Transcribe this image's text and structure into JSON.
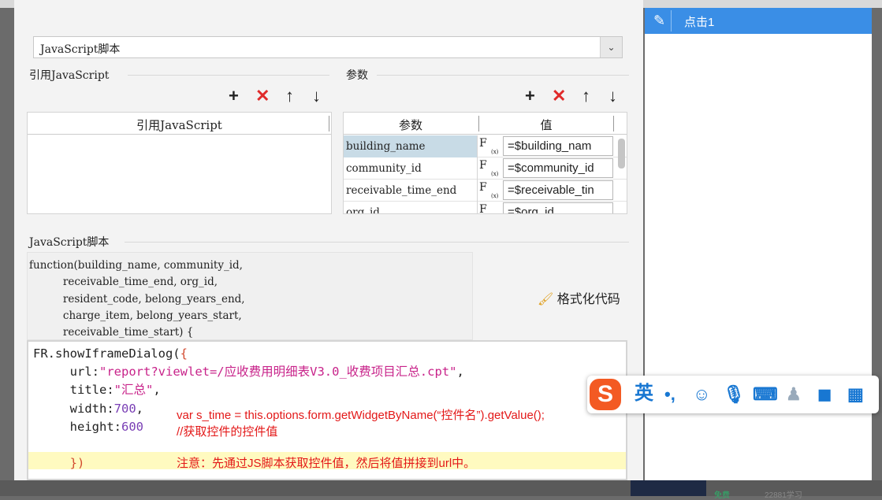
{
  "script_type": "JavaScript脚本",
  "ref_js": {
    "title": "引用JavaScript",
    "column": "引用JavaScript"
  },
  "params": {
    "title": "参数",
    "col_param": "参数",
    "col_value": "值",
    "rows": [
      {
        "name": "building_name",
        "value": "=$building_nam"
      },
      {
        "name": "community_id",
        "value": "=$community_id"
      },
      {
        "name": "receivable_time_end",
        "value": "=$receivable_tin"
      },
      {
        "name": "org_id",
        "value": "=$org_id"
      }
    ]
  },
  "js_section_title": "JavaScript脚本",
  "signature": "function(building_name, community_id,\n          receivable_time_end, org_id,\n          resident_code, belong_years_end,\n          charge_item, belong_years_start,\n          receivable_time_start) {",
  "format_button": "格式化代码",
  "code": {
    "line1": "FR.showIframeDialog(",
    "line1_brace": "{",
    "url_key": "url:",
    "url_val": "\"report?viewlet=/应收费用明细表V3.0_收费项目汇总.cpt\"",
    "title_key": "title:",
    "title_val": "\"汇总\"",
    "width_key": "width:",
    "width_val": "700",
    "height_key": "height:",
    "height_val": "600",
    "close": "})"
  },
  "annotations": {
    "note1": "var s_time = this.options.form.getWidgetByName(“控件名”).getValue();",
    "note2": "//获取控件的控件值",
    "note3": "注意：先通过JS脚本获取控件值，然后将值拼接到url中。"
  },
  "right_panel": {
    "item_label": "点击1"
  },
  "ime": {
    "lang": "英",
    "logo": "S"
  },
  "bottom": {
    "t1": "免费",
    "t2": "22881学习"
  },
  "fx_label": "F",
  "fx_sub": "(x)"
}
